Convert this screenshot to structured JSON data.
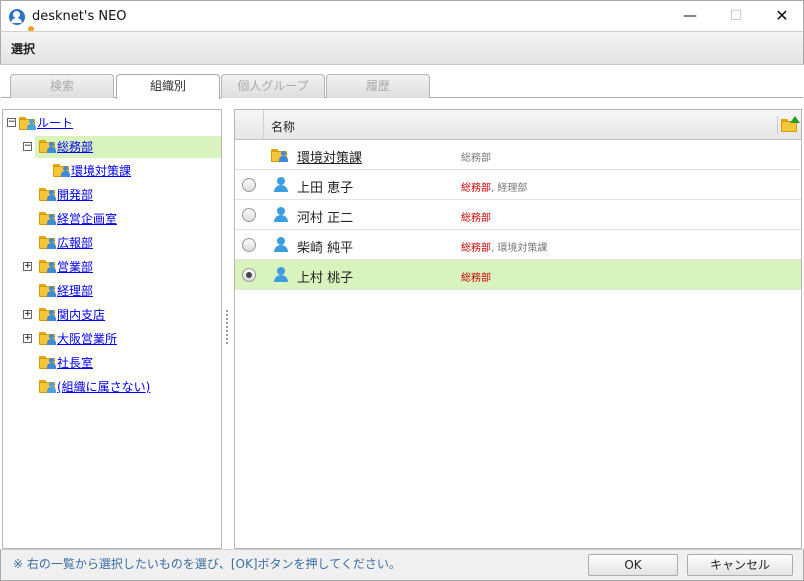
{
  "window": {
    "title": "desknet's NEO",
    "minimize_glyph": "—",
    "maximize_glyph": "☐",
    "close_glyph": "✕"
  },
  "header": {
    "title": "選択"
  },
  "tabs": [
    {
      "label": "検索",
      "active": false
    },
    {
      "label": "組織別",
      "active": true
    },
    {
      "label": "個人グループ",
      "active": false
    },
    {
      "label": "履歴",
      "active": false
    }
  ],
  "tree": {
    "root": "ルート",
    "items": [
      {
        "label": "総務部",
        "expander": "−",
        "selected": true
      },
      {
        "label": "環境対策課"
      },
      {
        "label": "開発部"
      },
      {
        "label": "経営企画室"
      },
      {
        "label": "広報部"
      },
      {
        "label": "営業部",
        "expander": "+"
      },
      {
        "label": "経理部"
      },
      {
        "label": "関内支店",
        "expander": "+"
      },
      {
        "label": "大阪営業所",
        "expander": "+"
      },
      {
        "label": "社長室"
      },
      {
        "label": "(組織に属さない)"
      }
    ]
  },
  "grid": {
    "column_name": "名称",
    "rows": [
      {
        "type": "group",
        "name": "環境対策課",
        "org_primary": "",
        "org_other": "総務部",
        "selected": false
      },
      {
        "type": "user",
        "name": "上田 恵子",
        "org_primary": "総務部",
        "org_other": ", 経理部",
        "selected": false
      },
      {
        "type": "user",
        "name": "河村 正二",
        "org_primary": "総務部",
        "org_other": "",
        "selected": false
      },
      {
        "type": "user",
        "name": "柴崎 純平",
        "org_primary": "総務部",
        "org_other": ", 環境対策課",
        "selected": false
      },
      {
        "type": "user",
        "name": "上村 桃子",
        "org_primary": "総務部",
        "org_other": "",
        "selected": true
      }
    ]
  },
  "footer": {
    "message": "※ 右の一覧から選択したいものを選び、[OK]ボタンを押してください。",
    "ok_label": "OK",
    "cancel_label": "キャンセル"
  },
  "colors": {
    "selection": "#d8f3be",
    "link": "#0000ee",
    "org_primary": "#cc0000",
    "footer_text": "#3a6ea5"
  },
  "icons": {
    "app": "desknets-app-icon",
    "folder": "folder-user-icon",
    "user": "user-icon",
    "up_folder": "folder-up-icon"
  }
}
